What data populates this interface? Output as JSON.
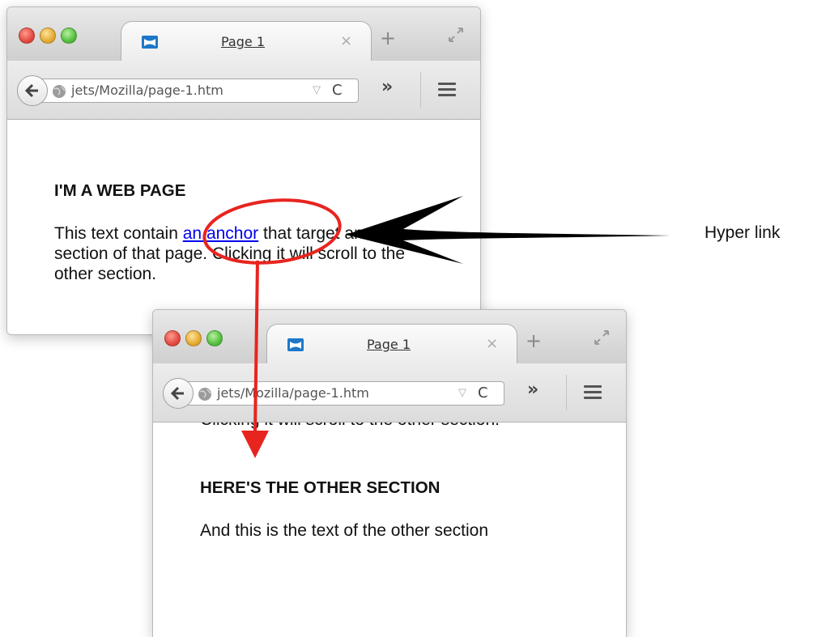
{
  "browser": {
    "tab_title": "Page 1",
    "tab_close": "×",
    "new_tab": "+",
    "url": "jets/Mozilla/page-1.htm",
    "url_dropmarker": "▽",
    "reload": "C",
    "overflow": "»"
  },
  "page_before": {
    "heading": "I'M A WEB PAGE",
    "text_before_link": "This text contain ",
    "link_text": "an anchor",
    "text_after_link": " that target another section of that page. Clicking it will scroll to the other section."
  },
  "page_after": {
    "scrolled_text": "Clicking it will scroll to the other section.",
    "heading": "HERE'S THE OTHER SECTION",
    "text": "And this is the text of the other section"
  },
  "annotation": {
    "label": "Hyper link",
    "circle_color": "#e8241f",
    "arrow_color": "#000000"
  }
}
